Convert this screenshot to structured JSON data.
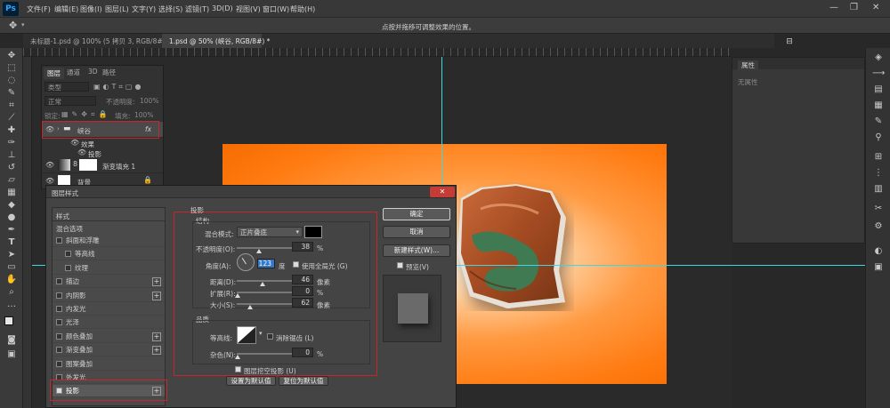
{
  "app": {
    "logo": "Ps"
  },
  "menu": [
    "文件(F)",
    "编辑(E)",
    "图像(I)",
    "图层(L)",
    "文字(Y)",
    "选择(S)",
    "滤镜(T)",
    "3D(D)",
    "视图(V)",
    "窗口(W)",
    "帮助(H)"
  ],
  "window_controls": [
    "—",
    "❐",
    "✕"
  ],
  "options_bar": {
    "hint": "点按并拖移可调整效果的位置。"
  },
  "doc_tabs": [
    {
      "label": "未标题-1.psd @ 100% (5 拷贝 3, RGB/8#) *",
      "active": false
    },
    {
      "label": "1.psd @ 50% (峡谷, RGB/8#) *",
      "active": true
    }
  ],
  "layers_panel": {
    "tabs": [
      "图层",
      "通道",
      "3D",
      "路径"
    ],
    "kind_filter": "类型",
    "blend_mode": "正常",
    "opacity_label": "不透明度:",
    "opacity_value": "100%",
    "lock_label": "锁定:",
    "fill_label": "填充:",
    "fill_value": "100%",
    "layers": [
      {
        "name": "峡谷",
        "type": "group",
        "fx": "fx"
      },
      {
        "name": "效果",
        "type": "effects-header"
      },
      {
        "name": "投影",
        "type": "effect"
      },
      {
        "name": "渐变填充 1",
        "type": "fill"
      },
      {
        "name": "背景",
        "type": "background"
      }
    ]
  },
  "layer_style_dialog": {
    "title": "图层样式",
    "close": "✕",
    "styles_header": "样式",
    "blend_options": "混合选项",
    "style_items": [
      {
        "label": "斜面和浮雕",
        "checked": false,
        "plus": false,
        "indent": false
      },
      {
        "label": "等高线",
        "checked": false,
        "plus": false,
        "indent": true
      },
      {
        "label": "纹理",
        "checked": false,
        "plus": false,
        "indent": true
      },
      {
        "label": "描边",
        "checked": false,
        "plus": true,
        "indent": false
      },
      {
        "label": "内阴影",
        "checked": false,
        "plus": true,
        "indent": false
      },
      {
        "label": "内发光",
        "checked": false,
        "plus": false,
        "indent": false
      },
      {
        "label": "光泽",
        "checked": false,
        "plus": false,
        "indent": false
      },
      {
        "label": "颜色叠加",
        "checked": false,
        "plus": true,
        "indent": false
      },
      {
        "label": "渐变叠加",
        "checked": false,
        "plus": true,
        "indent": false
      },
      {
        "label": "图案叠加",
        "checked": false,
        "plus": false,
        "indent": false
      },
      {
        "label": "外发光",
        "checked": false,
        "plus": false,
        "indent": false
      },
      {
        "label": "投影",
        "checked": true,
        "plus": true,
        "indent": false,
        "selected": true
      }
    ],
    "drop_shadow": {
      "section_title": "投影",
      "structure_title": "结构",
      "blend_mode_label": "混合模式:",
      "blend_mode_value": "正片叠底",
      "shadow_color": "#000000",
      "opacity_label": "不透明度(O):",
      "opacity_value": "38",
      "opacity_unit": "%",
      "angle_label": "角度(A):",
      "angle_value": "123",
      "angle_unit": "度",
      "global_light_label": "使用全局光 (G)",
      "global_light_checked": true,
      "distance_label": "距离(D):",
      "distance_value": "46",
      "distance_unit": "像素",
      "spread_label": "扩展(R):",
      "spread_value": "0",
      "spread_unit": "%",
      "size_label": "大小(S):",
      "size_value": "62",
      "size_unit": "像素",
      "quality_title": "品质",
      "contour_label": "等高线:",
      "antialias_label": "消除锯齿 (L)",
      "noise_label": "杂色(N):",
      "noise_value": "0",
      "noise_unit": "%",
      "knockout_label": "图层挖空投影 (U)",
      "knockout_checked": true,
      "make_default": "设置为默认值",
      "reset_default": "复位为默认值"
    },
    "buttons": {
      "ok": "确定",
      "cancel": "取消",
      "new_style": "新建样式(W)...",
      "preview_label": "预览(V)",
      "preview_checked": true
    }
  },
  "properties_panel": {
    "tab": "属性",
    "content": "无属性"
  },
  "colors": {
    "accent_red": "#c3262b",
    "guide": "#3ad8e6",
    "orange": "#ff7a10"
  }
}
